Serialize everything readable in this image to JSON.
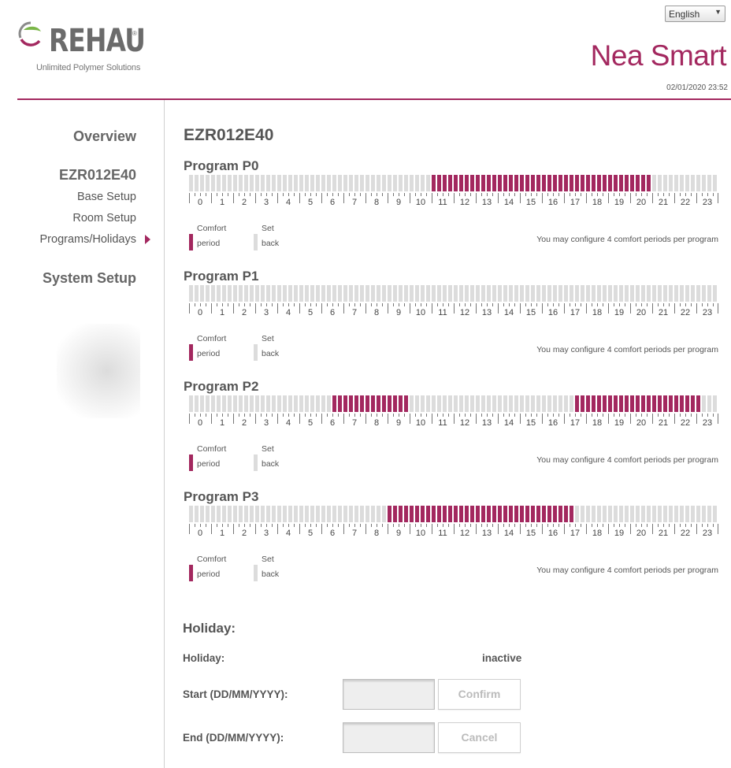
{
  "header": {
    "brand": "REHAU",
    "brand_mark": "®",
    "tagline": "Unlimited Polymer Solutions",
    "language": {
      "selected": "English"
    },
    "app_title": "Nea Smart",
    "datetime": "02/01/2020 23:52"
  },
  "sidebar": {
    "overview": "Overview",
    "device": "EZR012E40",
    "items": [
      "Base Setup",
      "Room Setup",
      "Programs/Holidays"
    ],
    "active_item": "Programs/Holidays",
    "system_setup": "System Setup"
  },
  "main": {
    "device_title": "EZR012E40",
    "hours": [
      0,
      1,
      2,
      3,
      4,
      5,
      6,
      7,
      8,
      9,
      10,
      11,
      12,
      13,
      14,
      15,
      16,
      17,
      18,
      19,
      20,
      21,
      22,
      23
    ],
    "slots_per_hour": 4,
    "legend": {
      "comfort_line1": "Comfort",
      "comfort_line2": "period",
      "setback_line1": "Set",
      "setback_line2": "back"
    },
    "hint": "You may configure 4 comfort periods per program",
    "programs": [
      {
        "name": "Program P0",
        "comfort_periods": [
          [
            "11:00",
            "21:00"
          ]
        ]
      },
      {
        "name": "Program P1",
        "comfort_periods": []
      },
      {
        "name": "Program P2",
        "comfort_periods": [
          [
            "6:30",
            "10:00"
          ],
          [
            "17:30",
            "23:15"
          ]
        ]
      },
      {
        "name": "Program P3",
        "comfort_periods": [
          [
            "9:00",
            "17:30"
          ]
        ]
      }
    ]
  },
  "holiday": {
    "title": "Holiday:",
    "status_label": "Holiday:",
    "status": "inactive",
    "start_label": "Start (DD/MM/YYYY):",
    "end_label": "End (DD/MM/YYYY):",
    "start_value": "",
    "end_value": "",
    "confirm_label": "Confirm",
    "cancel_label": "Cancel"
  },
  "colors": {
    "accent": "#a3285f",
    "comfort": "#a3285f",
    "setback": "#dcdcdc"
  }
}
